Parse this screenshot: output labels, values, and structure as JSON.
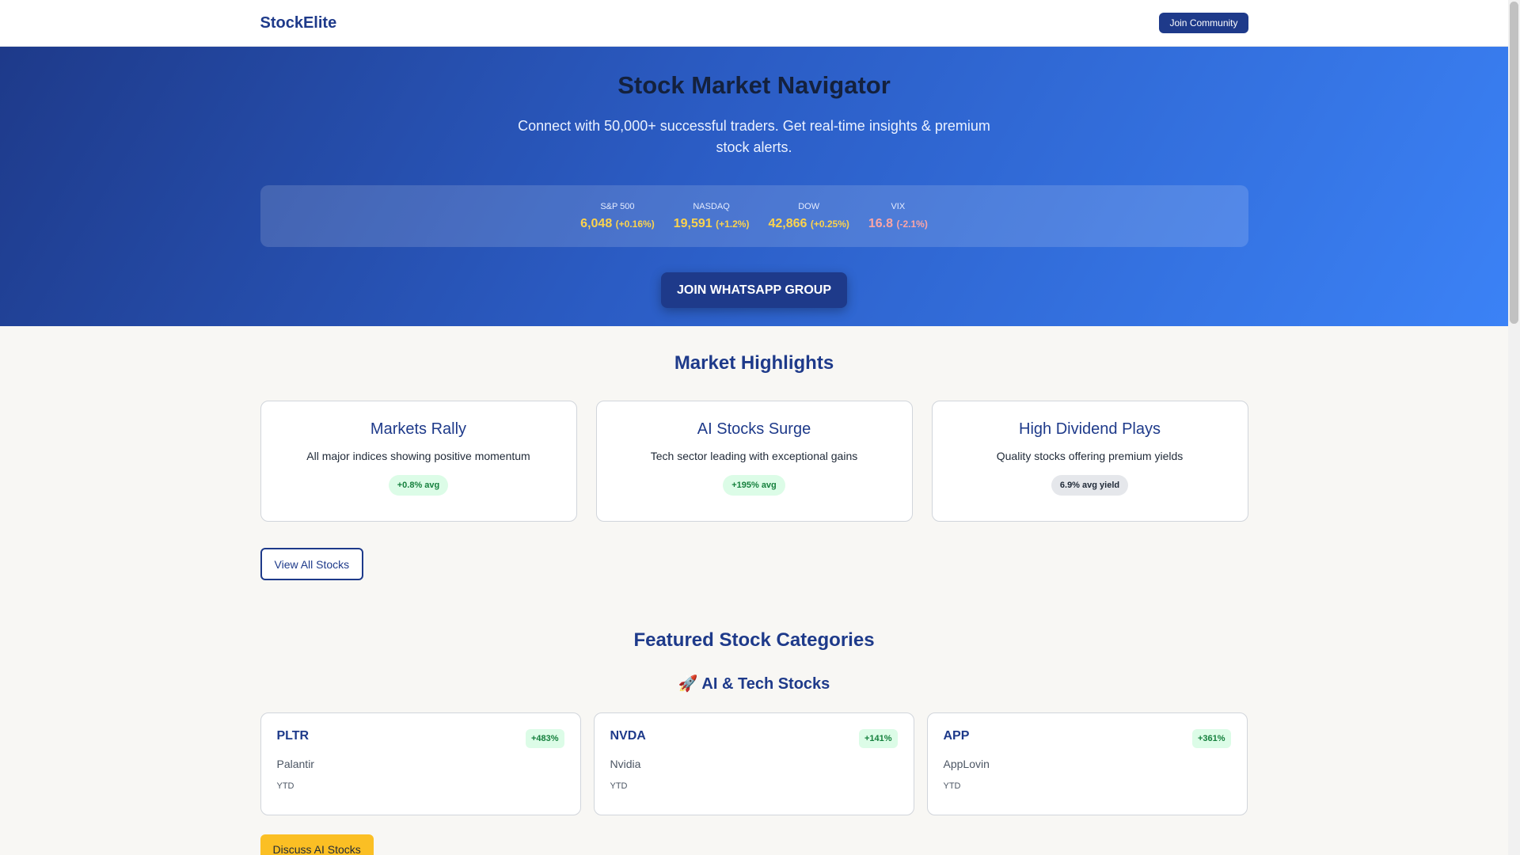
{
  "header": {
    "brand": "StockElite",
    "join_button": "Join Community"
  },
  "hero": {
    "title": "Stock Market Navigator",
    "subtitle": "Connect with 50,000+ successful traders. Get real-time insights & premium stock alerts.",
    "indices": [
      {
        "name": "S&P 500",
        "value": "6,048",
        "change": "(+0.16%)"
      },
      {
        "name": "NASDAQ",
        "value": "19,591",
        "change": "(+1.2%)"
      },
      {
        "name": "DOW",
        "value": "42,866",
        "change": "(+0.25%)"
      },
      {
        "name": "VIX",
        "value": "16.8",
        "change": "(-2.1%)"
      }
    ],
    "cta": "JOIN WHATSAPP GROUP"
  },
  "highlights": {
    "title": "Market Highlights",
    "cards": [
      {
        "title": "Markets Rally",
        "desc": "All major indices showing positive momentum",
        "badge": "+0.8% avg"
      },
      {
        "title": "AI Stocks Surge",
        "desc": "Tech sector leading with exceptional gains",
        "badge": "+195% avg"
      },
      {
        "title": "High Dividend Plays",
        "desc": "Quality stocks offering premium yields",
        "badge": "6.9% avg yield"
      }
    ],
    "view_all": "View All Stocks"
  },
  "featured": {
    "title": "Featured Stock Categories",
    "category": {
      "icon": "🚀",
      "name": "AI & Tech Stocks",
      "stocks": [
        {
          "ticker": "PLTR",
          "change": "+483%",
          "name": "Palantir",
          "period": "YTD"
        },
        {
          "ticker": "NVDA",
          "change": "+141%",
          "name": "Nvidia",
          "period": "YTD"
        },
        {
          "ticker": "APP",
          "change": "+361%",
          "name": "AppLovin",
          "period": "YTD"
        }
      ],
      "discuss": "Discuss AI Stocks"
    }
  }
}
